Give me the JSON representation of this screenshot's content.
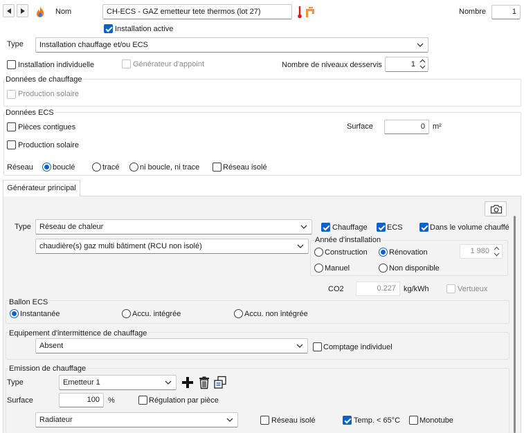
{
  "header": {
    "name_label": "Nom",
    "name_value": "CH-ECS - GAZ emetteur tete thermos (lot 27)",
    "nombre_label": "Nombre",
    "nombre_value": "1",
    "installation_active_label": "Installation active",
    "installation_active_checked": true
  },
  "installation": {
    "type_label": "Type",
    "type_value": "Installation chauffage et/ou ECS",
    "individuelle_label": "Installation individuelle",
    "appoint_label": "Générateur d'appoint",
    "niveaux_label": "Nombre de niveaux desservis",
    "niveaux_value": "1"
  },
  "donnees_chauffage": {
    "title": "Données de chauffage",
    "production_solaire_label": "Production solaire"
  },
  "donnees_ecs": {
    "title": "Données ECS",
    "pieces_contigues_label": "Pièces contigues",
    "surface_label": "Surface",
    "surface_value": "0",
    "surface_unit": "m²",
    "production_solaire_label": "Production solaire",
    "reseau_label": "Réseau",
    "reseau_options": [
      "bouclé",
      "tracé",
      "ni boucle, ni trace"
    ],
    "reseau_selected": "bouclé",
    "reseau_isole_label": "Réseau isolé"
  },
  "tab": {
    "label": "Générateur principal"
  },
  "generateur": {
    "type_label": "Type",
    "type_value": "Réseau de chaleur",
    "subtype_value": "chaudière(s) gaz multi bâtiment (RCU non isolé)",
    "chauffage_label": "Chauffage",
    "ecs_label": "ECS",
    "volume_chauffe_label": "Dans le volume chauffé",
    "annee_title": "Année d'installation",
    "construction_label": "Construction",
    "renovation_label": "Rénovation",
    "annee_value": "1 980",
    "manuel_label": "Manuel",
    "non_disponible_label": "Non disponible",
    "co2_label": "CO2",
    "co2_value": "0.227",
    "co2_unit": "kg/kWh",
    "vertueux_label": "Vertueux"
  },
  "ballon": {
    "title": "Ballon ECS",
    "options": [
      "Instantanée",
      "Accu. intégrée",
      "Accu. non intégrée"
    ],
    "selected": "Instantanée"
  },
  "intermittence": {
    "title": "Equipement d'intermittence de chauffage",
    "value": "Absent",
    "comptage_label": "Comptage individuel"
  },
  "emission": {
    "title": "Emission de chauffage",
    "type_label": "Type",
    "type_value": "Emetteur 1",
    "surface_label": "Surface",
    "surface_value": "100",
    "surface_unit": "%",
    "regulation_label": "Régulation par pièce",
    "emetteur_value": "Radiateur",
    "reseau_isole_label": "Réseau isolé",
    "temp_label": "Temp. < 65°C",
    "monotube_label": "Monotube"
  },
  "colors": {
    "accent": "#0f62c5",
    "flame_orange": "#f07a1a",
    "thermo_red": "#d11a1a",
    "faucet_orange": "#e89a2a"
  }
}
